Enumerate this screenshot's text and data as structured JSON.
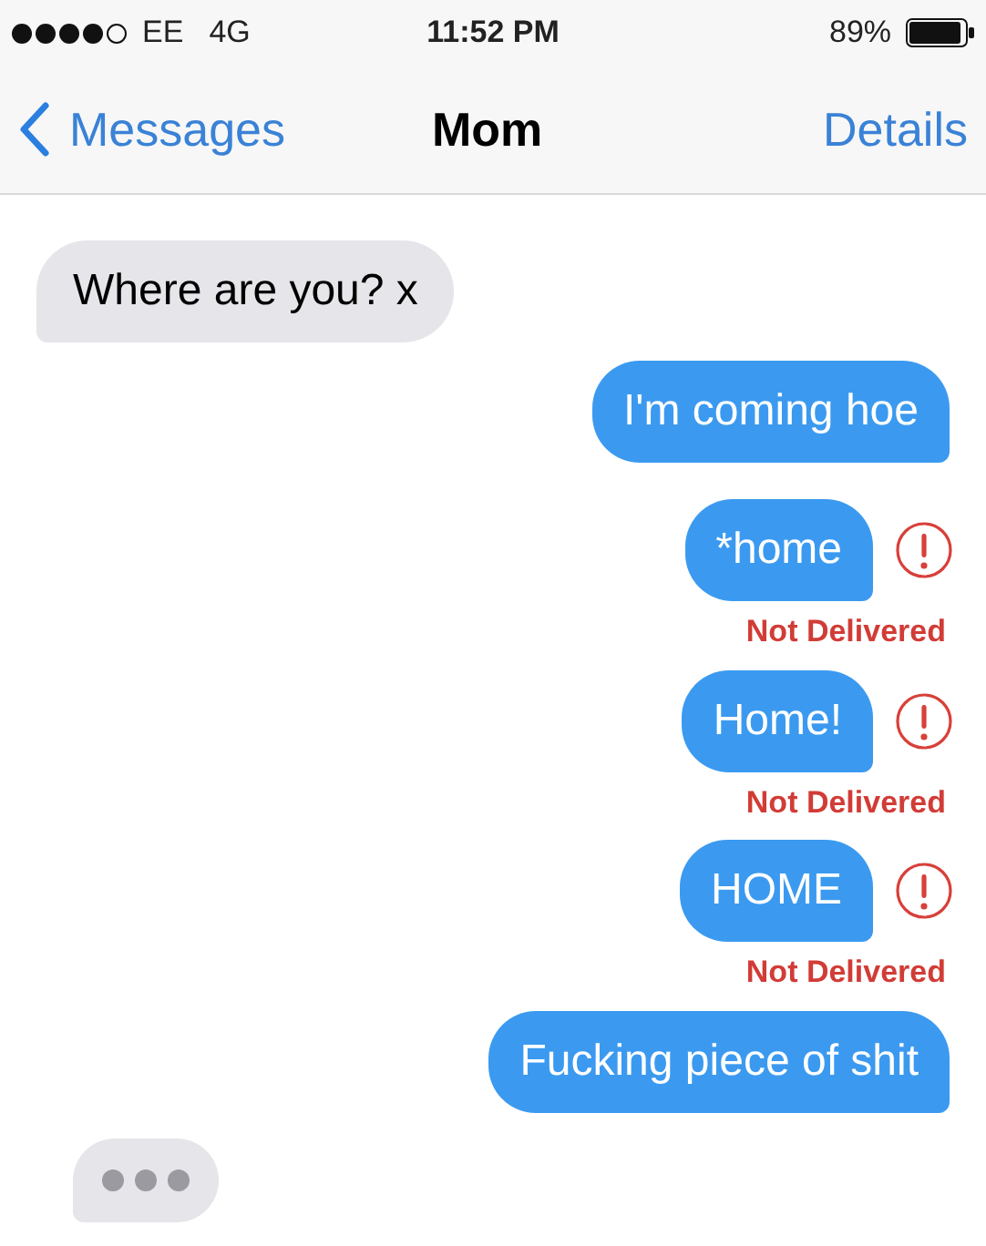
{
  "status_bar": {
    "carrier": "EE",
    "network": "4G",
    "time": "11:52 PM",
    "battery": "89%"
  },
  "nav": {
    "back": "Messages",
    "title": "Mom",
    "action": "Details"
  },
  "messages": [
    {
      "kind": "incoming",
      "text": "Where are you? x",
      "failed": false
    },
    {
      "kind": "outgoing",
      "text": "I'm coming hoe",
      "failed": false
    },
    {
      "kind": "outgoing",
      "text": "*home",
      "failed": true,
      "status": "Not Delivered"
    },
    {
      "kind": "outgoing",
      "text": "Home!",
      "failed": true,
      "status": "Not Delivered"
    },
    {
      "kind": "outgoing",
      "text": "HOME",
      "failed": true,
      "status": "Not Delivered"
    },
    {
      "kind": "outgoing",
      "text": "Fucking piece of shit",
      "failed": false
    }
  ],
  "typing": true
}
